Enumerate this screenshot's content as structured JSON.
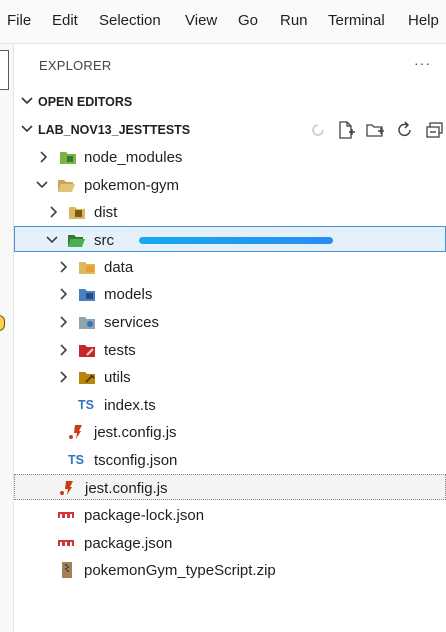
{
  "menubar": {
    "items": [
      "File",
      "Edit",
      "Selection",
      "View",
      "Go",
      "Run",
      "Terminal",
      "Help"
    ]
  },
  "explorer": {
    "title": "EXPLORER",
    "more_glyph": "···",
    "open_editors_label": "OPEN EDITORS",
    "project_label": "LAB_NOV13_JESTTESTS"
  },
  "tree": {
    "node_modules": "node_modules",
    "pokemon_gym": "pokemon-gym",
    "dist": "dist",
    "src": "src",
    "data": "data",
    "models": "models",
    "services": "services",
    "tests": "tests",
    "utils": "utils",
    "index_ts": "index.ts",
    "jest_config_inner": "jest.config.js",
    "tsconfig": "tsconfig.json",
    "jest_config_root": "jest.config.js",
    "package_lock": "package-lock.json",
    "package_json": "package.json",
    "zip": "pokemonGym_typeScript.zip"
  },
  "icons": {
    "ts_glyph": "TS"
  },
  "colors": {
    "selection_bg": "#e4f0fa",
    "selection_border": "#4a90d4",
    "ts_blue": "#2f74c0",
    "folder_yellow": "#dcb660"
  }
}
